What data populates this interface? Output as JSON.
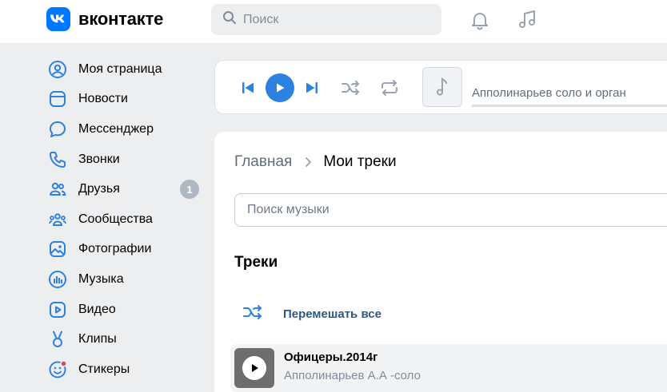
{
  "header": {
    "logo_text": "вконтакте",
    "search_placeholder": "Поиск",
    "icons": [
      "bell-icon",
      "music-note-icon"
    ]
  },
  "sidebar": {
    "items": [
      {
        "label": "Моя страница",
        "icon": "user-circle-icon"
      },
      {
        "label": "Новости",
        "icon": "newsfeed-icon"
      },
      {
        "label": "Мессенджер",
        "icon": "message-icon"
      },
      {
        "label": "Звонки",
        "icon": "phone-icon"
      },
      {
        "label": "Друзья",
        "icon": "users-icon",
        "badge": "1"
      },
      {
        "label": "Сообщества",
        "icon": "community-icon"
      },
      {
        "label": "Фотографии",
        "icon": "photo-icon"
      },
      {
        "label": "Музыка",
        "icon": "music-icon"
      },
      {
        "label": "Видео",
        "icon": "video-icon"
      },
      {
        "label": "Клипы",
        "icon": "clips-icon"
      },
      {
        "label": "Стикеры",
        "icon": "sticker-icon"
      }
    ]
  },
  "player": {
    "track_title": "Апполинарьев соло и орган"
  },
  "main": {
    "breadcrumb_home": "Главная",
    "breadcrumb_current": "Мои треки",
    "music_search_placeholder": "Поиск музыки",
    "section_title": "Треки",
    "shuffle_all_label": "Перемешать все",
    "tracks": [
      {
        "title": "Офицеры.2014г",
        "artist": "Апполинарьев А.А -соло"
      }
    ]
  },
  "colors": {
    "brand": "#0077ff",
    "accent": "#2d81e0",
    "link": "#2a5885",
    "sticker_dot": "#e64646"
  }
}
